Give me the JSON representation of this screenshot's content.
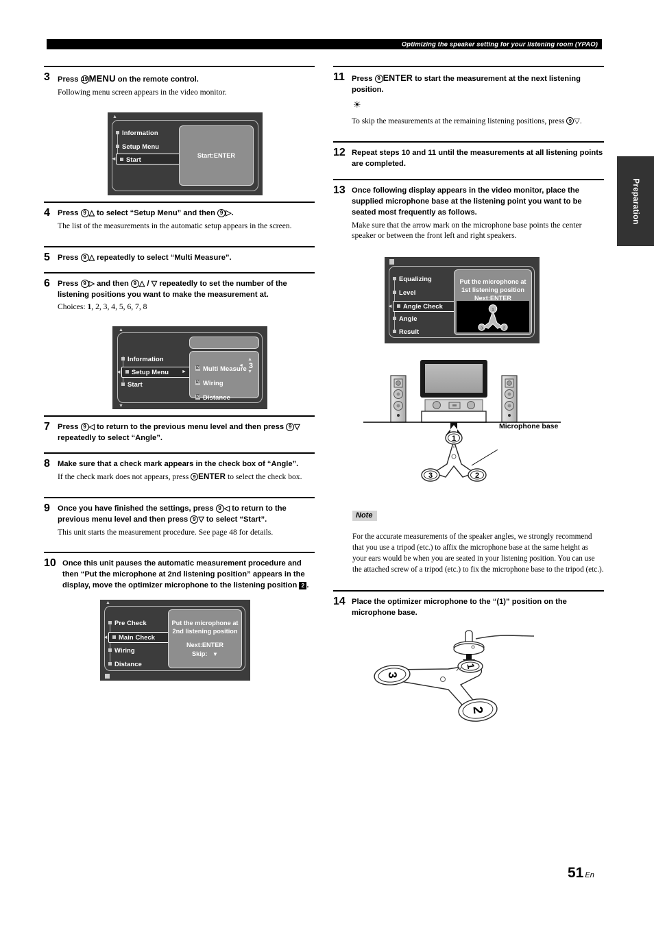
{
  "header": {
    "running_title": "Optimizing the speaker setting for your listening room (YPAO)"
  },
  "side_tab": {
    "label": "Preparation"
  },
  "page": {
    "number": "51",
    "lang": "En"
  },
  "left_column": {
    "step3": {
      "num": "3",
      "title_a": "Press ",
      "key_circle": "19",
      "key_bold": "MENU",
      "title_b": " on the remote control.",
      "desc": "Following menu screen appears in the video monitor."
    },
    "step4": {
      "num": "4",
      "title_a": "Press ",
      "key1_circle": "9",
      "key1_tri": "△",
      "title_b": " to select “Setup Menu” and then ",
      "key2_circle": "9",
      "key2_tri": "▷",
      "title_c": ".",
      "desc": "The list of the measurements in the automatic setup appears in the screen."
    },
    "step5": {
      "num": "5",
      "title_a": "Press ",
      "key1_circle": "9",
      "key1_tri": "△",
      "title_b": " repeatedly to select “Multi Measure”."
    },
    "step6": {
      "num": "6",
      "title_a": "Press ",
      "key1_circle": "9",
      "key1_tri": "▷",
      "title_b": " and then ",
      "key2_circle": "9",
      "key2_tri": "△",
      "title_c": " / ",
      "key3_tri": "▽",
      "title_d": " repeatedly to set the number of the listening positions you want to make the measurement at.",
      "choices_label": "Choices: ",
      "choices_default": "1",
      "choices_rest": ", 2, 3, 4, 5, 6, 7, 8"
    },
    "step7": {
      "num": "7",
      "title_a": "Press ",
      "key1_circle": "9",
      "key1_tri": "◁",
      "title_b": " to return to the previous menu level and then press ",
      "key2_circle": "9",
      "key2_tri": "▽",
      "title_c": " repeatedly to select “Angle”."
    },
    "step8": {
      "num": "8",
      "title": "Make sure that a check mark appears in the check box of “Angle”.",
      "desc_a": "If the check mark does not appears, press ",
      "key_circle": "9",
      "key_bold": "ENTER",
      "desc_b": " to select the check box."
    },
    "step9": {
      "num": "9",
      "title_a": "Once you have finished the settings, press ",
      "key1_circle": "9",
      "key1_tri": "◁",
      "title_b": " to return to the previous menu level and then press ",
      "key2_circle": "9",
      "key2_tri": "▽",
      "title_c": " to select “Start”.",
      "desc": "This unit starts the measurement procedure. See page 48 for details."
    },
    "step10": {
      "num": "10",
      "title_a": "Once this unit pauses the automatic measurement procedure and then “Put the microphone at 2nd listening position” appears in the display, move the optimizer microphone to the listening position ",
      "marker": "2",
      "title_b": "."
    }
  },
  "right_column": {
    "step11": {
      "num": "11",
      "title_a": "Press ",
      "key_circle": "9",
      "key_bold": "ENTER",
      "title_b": " to start the measurement at the next listening position.",
      "tip_a": "To skip the measurements at the remaining listening positions, press ",
      "tip_circle": "9",
      "tip_tri": "▽",
      "tip_b": "."
    },
    "step12": {
      "num": "12",
      "title": "Repeat steps 10 and 11 until the measurements at all listening points are completed."
    },
    "step13": {
      "num": "13",
      "title": "Once following display appears in the video monitor, place the supplied microphone base at the listening point you want to be seated most frequently as follows.",
      "desc": "Make sure that the arrow mark on the microphone base points the center speaker or between the front left and right speakers."
    },
    "diagram": {
      "caption": "Microphone base",
      "pos1": "1",
      "pos2": "2",
      "pos3": "3"
    },
    "note": {
      "tag": "Note",
      "text": "For the accurate measurements of the speaker angles, we strongly recommend that you use a tripod (etc.) to affix the microphone base at the same height as your ears would be when you are seated in your listening position. You can use the attached screw of a tripod (etc.) to fix the microphone base to the tripod (etc.)."
    },
    "step14": {
      "num": "14",
      "title": "Place the optimizer microphone to the “(1)” position on the microphone base."
    },
    "mic_base_figure": {
      "pos1": "1",
      "pos2": "2",
      "pos3": "3"
    }
  },
  "osd_screens": {
    "screen1": {
      "items": [
        "Information",
        "Setup Menu",
        "Start"
      ],
      "selected": "Start",
      "pane_text": "Start:ENTER"
    },
    "screen2": {
      "items": [
        "Information",
        "Setup Menu",
        "Start"
      ],
      "selected": "Setup Menu",
      "sub_items": [
        {
          "label": "Multi Measure",
          "value": "3"
        },
        {
          "label": "Wiring",
          "value": ""
        },
        {
          "label": "Distance",
          "value": ""
        }
      ],
      "check_glyph": "☑"
    },
    "screen3": {
      "items": [
        "Pre Check",
        "Main Check",
        "Wiring",
        "Distance"
      ],
      "selected": "Main Check",
      "pane_line1": "Put the microphone at",
      "pane_line2": "2nd listening position",
      "pane_line3": "Next:ENTER",
      "pane_line4": "Skip:"
    },
    "screen4": {
      "items": [
        "Equalizing",
        "Level",
        "Angle Check",
        "Angle",
        "Result"
      ],
      "selected": "Angle Check",
      "pane_line1": "Put the microphone at",
      "pane_line2": "1st listening position",
      "pane_line3": "Next:ENTER",
      "mic_pos1": "1",
      "mic_pos2": "2",
      "mic_pos3": "3"
    }
  }
}
